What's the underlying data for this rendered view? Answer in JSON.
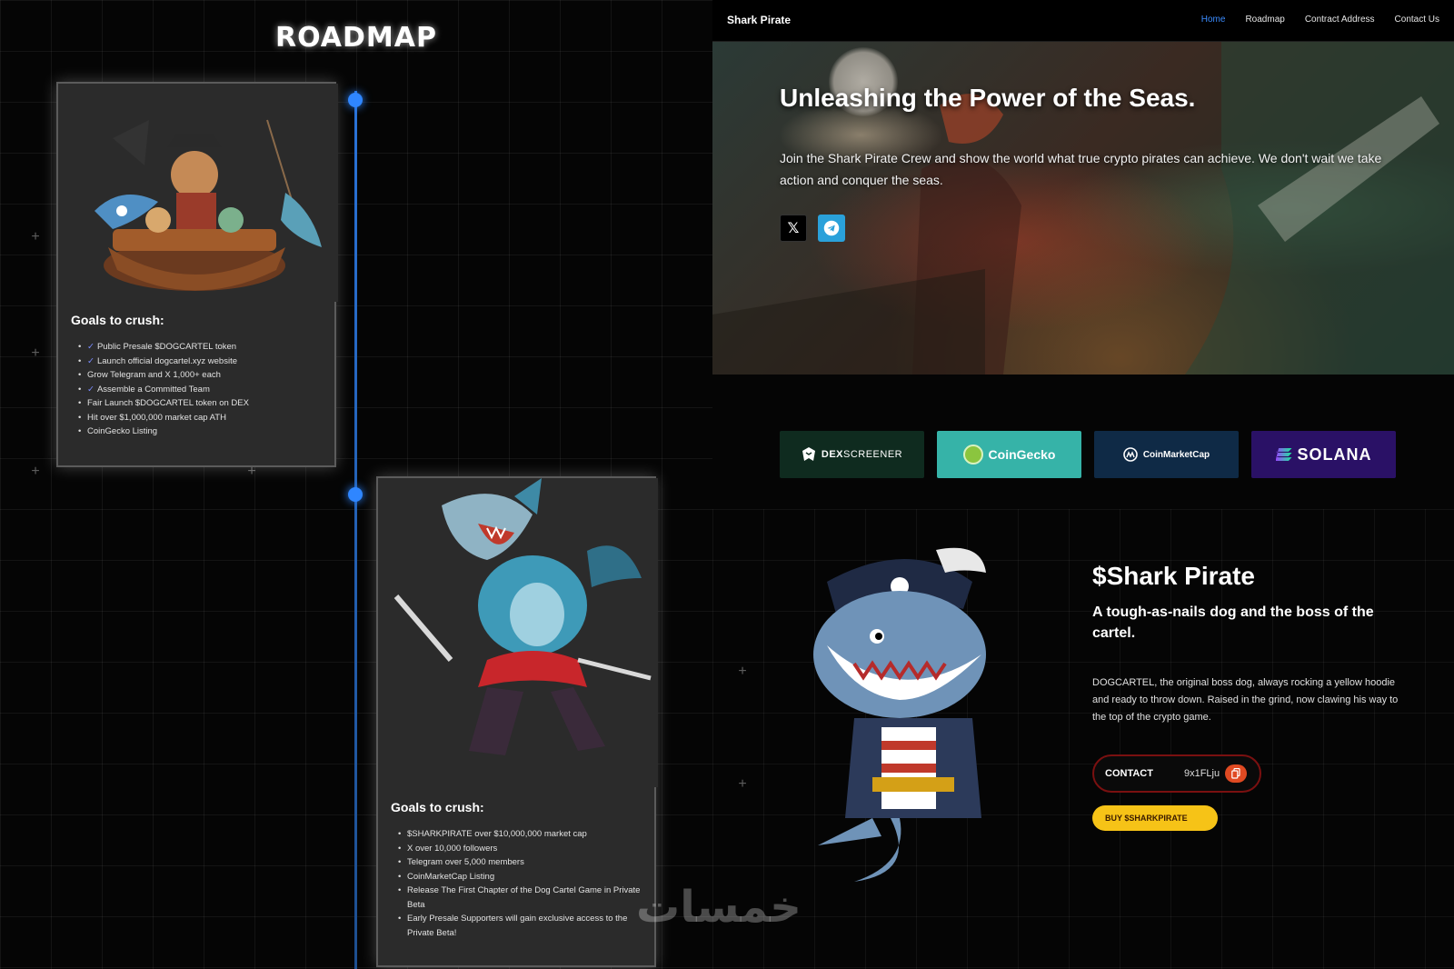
{
  "roadmap": {
    "title": "ROADMAP",
    "phases": [
      {
        "heading": "Goals to crush:",
        "goals": [
          {
            "text": "Public Presale $DOGCARTEL token",
            "checked": true
          },
          {
            "text": "Launch official dogcartel.xyz website",
            "checked": true
          },
          {
            "text": "Grow Telegram and X 1,000+ each",
            "checked": false
          },
          {
            "text": "Assemble a Committed Team",
            "checked": true
          },
          {
            "text": "Fair Launch $DOGCARTEL token on DEX",
            "checked": false
          },
          {
            "text": "Hit over $1,000,000 market cap ATH",
            "checked": false
          },
          {
            "text": "CoinGecko Listing",
            "checked": false
          }
        ]
      },
      {
        "heading": "Goals to crush:",
        "goals": [
          {
            "text": "$SHARKPIRATE over $10,000,000 market cap",
            "checked": false
          },
          {
            "text": "X over 10,000 followers",
            "checked": false
          },
          {
            "text": "Telegram over 5,000 members",
            "checked": false
          },
          {
            "text": "CoinMarketCap Listing",
            "checked": false
          },
          {
            "text": "Release The First Chapter of the Dog Cartel Game in Private Beta",
            "checked": false
          },
          {
            "text": "Early Presale Supporters will gain exclusive access to the Private Beta!",
            "checked": false
          }
        ]
      }
    ]
  },
  "site": {
    "brand": "Shark Pirate",
    "nav": [
      {
        "label": "Home",
        "active": true
      },
      {
        "label": "Roadmap",
        "active": false
      },
      {
        "label": "Contract Address",
        "active": false
      },
      {
        "label": "Contact Us",
        "active": false
      }
    ],
    "hero": {
      "title": "Unleashing the Power of the Seas.",
      "text": "Join the Shark Pirate Crew and show the world what true crypto pirates can achieve. We don't wait we take action and conquer the seas.",
      "social": [
        {
          "icon": "x-icon",
          "label": "X"
        },
        {
          "icon": "telegram-icon",
          "label": "Telegram"
        }
      ]
    },
    "partners": [
      {
        "name": "DEXSCREENER",
        "prefix": "DEX",
        "suffix": "SCREENER",
        "color": "#0f2b1f"
      },
      {
        "name": "CoinGecko",
        "color": "#36b3a8"
      },
      {
        "name": "CoinMarketCap",
        "color": "#0f2a46"
      },
      {
        "name": "SOLANA",
        "color": "#2a1166"
      }
    ],
    "token": {
      "title": "$Shark Pirate",
      "subtitle": "A tough-as-nails dog and the boss of the cartel.",
      "description": "DOGCARTEL, the original boss dog, always rocking a yellow hoodie and ready to throw down. Raised in the grind, now clawing his way to the top of the crypto game.",
      "contact_label": "CONTACT",
      "contract_short": "9x1FLju",
      "buy_label": "BUY $SHARKPIRATE"
    }
  },
  "watermark": "خمسات",
  "colors": {
    "accent_blue": "#3b8cff",
    "timeline_blue": "#2f86ff",
    "buy_yellow": "#f6c317",
    "copy_orange": "#e04a22",
    "coingecko_teal": "#36b3a8"
  }
}
